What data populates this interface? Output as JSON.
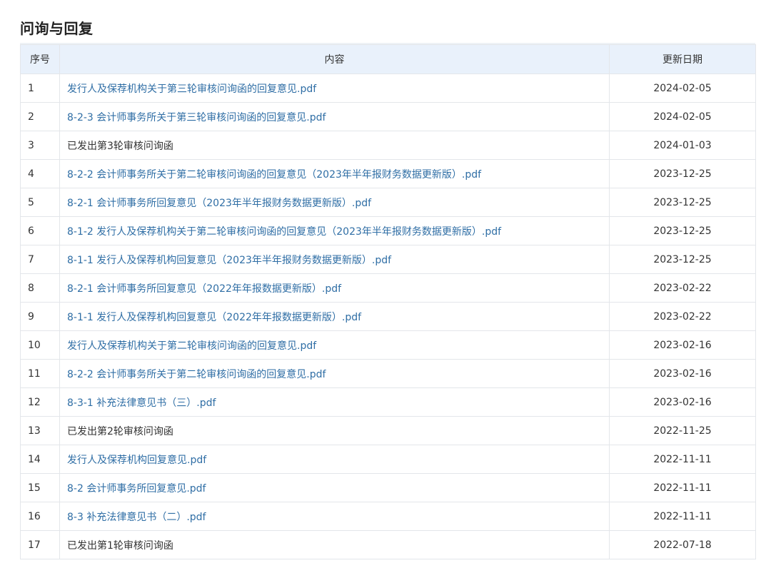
{
  "section": {
    "title": "问询与回复"
  },
  "table": {
    "headers": {
      "no": "序号",
      "content": "内容",
      "date": "更新日期"
    },
    "rows": [
      {
        "no": "1",
        "content": "发行人及保荐机构关于第三轮审核问询函的回复意见.pdf",
        "date": "2024-02-05",
        "is_link": true
      },
      {
        "no": "2",
        "content": "8-2-3 会计师事务所关于第三轮审核问询函的回复意见.pdf",
        "date": "2024-02-05",
        "is_link": true
      },
      {
        "no": "3",
        "content": "已发出第3轮审核问询函",
        "date": "2024-01-03",
        "is_link": false
      },
      {
        "no": "4",
        "content": "8-2-2 会计师事务所关于第二轮审核问询函的回复意见（2023年半年报财务数据更新版）.pdf",
        "date": "2023-12-25",
        "is_link": true
      },
      {
        "no": "5",
        "content": "8-2-1 会计师事务所回复意见（2023年半年报财务数据更新版）.pdf",
        "date": "2023-12-25",
        "is_link": true
      },
      {
        "no": "6",
        "content": "8-1-2 发行人及保荐机构关于第二轮审核问询函的回复意见（2023年半年报财务数据更新版）.pdf",
        "date": "2023-12-25",
        "is_link": true
      },
      {
        "no": "7",
        "content": "8-1-1 发行人及保荐机构回复意见（2023年半年报财务数据更新版）.pdf",
        "date": "2023-12-25",
        "is_link": true
      },
      {
        "no": "8",
        "content": "8-2-1 会计师事务所回复意见（2022年年报数据更新版）.pdf",
        "date": "2023-02-22",
        "is_link": true
      },
      {
        "no": "9",
        "content": "8-1-1 发行人及保荐机构回复意见（2022年年报数据更新版）.pdf",
        "date": "2023-02-22",
        "is_link": true
      },
      {
        "no": "10",
        "content": "发行人及保荐机构关于第二轮审核问询函的回复意见.pdf",
        "date": "2023-02-16",
        "is_link": true
      },
      {
        "no": "11",
        "content": "8-2-2 会计师事务所关于第二轮审核问询函的回复意见.pdf",
        "date": "2023-02-16",
        "is_link": true
      },
      {
        "no": "12",
        "content": "8-3-1 补充法律意见书（三）.pdf",
        "date": "2023-02-16",
        "is_link": true
      },
      {
        "no": "13",
        "content": "已发出第2轮审核问询函",
        "date": "2022-11-25",
        "is_link": false
      },
      {
        "no": "14",
        "content": "发行人及保荐机构回复意见.pdf",
        "date": "2022-11-11",
        "is_link": true
      },
      {
        "no": "15",
        "content": "8-2 会计师事务所回复意见.pdf",
        "date": "2022-11-11",
        "is_link": true
      },
      {
        "no": "16",
        "content": "8-3 补充法律意见书（二）.pdf",
        "date": "2022-11-11",
        "is_link": true
      },
      {
        "no": "17",
        "content": "已发出第1轮审核问询函",
        "date": "2022-07-18",
        "is_link": false
      }
    ]
  },
  "colors": {
    "link": "#2f6ea5",
    "text": "#333333",
    "header_bg": "#e9f1fb",
    "border": "#e3e6ea"
  }
}
